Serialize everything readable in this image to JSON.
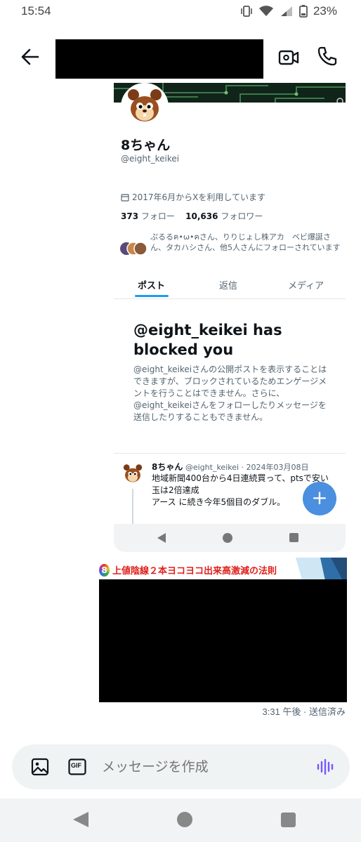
{
  "status_bar": {
    "time": "15:54",
    "battery": "23%"
  },
  "header": {
    "back_icon": "arrow-left-icon",
    "video_icon": "video-camera-icon",
    "call_icon": "phone-icon"
  },
  "screenshot": {
    "profile": {
      "name": "8ちゃん",
      "handle": "@eight_keikei",
      "joined": "2017年6月からXを利用しています",
      "following_count": "373",
      "following_label": "フォロー",
      "followers_count": "10,636",
      "followers_label": "フォロワー",
      "followed_by": "ぷるるฅ•ω•ฅさん、りりじょし株アカ　ベビ爆誕さん、タカハシさん、他5人さんにフォローされています"
    },
    "tabs": [
      "ポスト",
      "返信",
      "メディア"
    ],
    "blocked": {
      "title": "@eight_keikei has blocked you",
      "text": "@eight_keikeiさんの公開ポストを表示することはできますが、ブロックされているためエンゲージメントを行うことはできません。さらに、@eight_keikeiさんをフォローしたりメッセージを送信したりすることもできません。"
    },
    "post": {
      "name": "8ちゃん",
      "meta": "@eight_keikei · 2024年03月08日",
      "text_line1": "地域新聞400台から4日連続買って、ptsで安い玉は2倍達成",
      "text_line2": "アース に続き今年5個目のダブル。"
    },
    "fab_label": "+"
  },
  "image2": {
    "title": "上値陰線２本ヨコヨコ出来高激減の法則",
    "badge": "8"
  },
  "message_meta": "3:31 午後 · 送信済み",
  "composer": {
    "placeholder": "メッセージを作成",
    "gif_label": "GIF",
    "image_icon": "image-icon",
    "voice_icon": "voice-wave-icon"
  },
  "colors": {
    "accent": "#1d9bf0",
    "fab": "#4a8fe0",
    "voice": "#7856ff",
    "image_title": "#e0201b"
  }
}
